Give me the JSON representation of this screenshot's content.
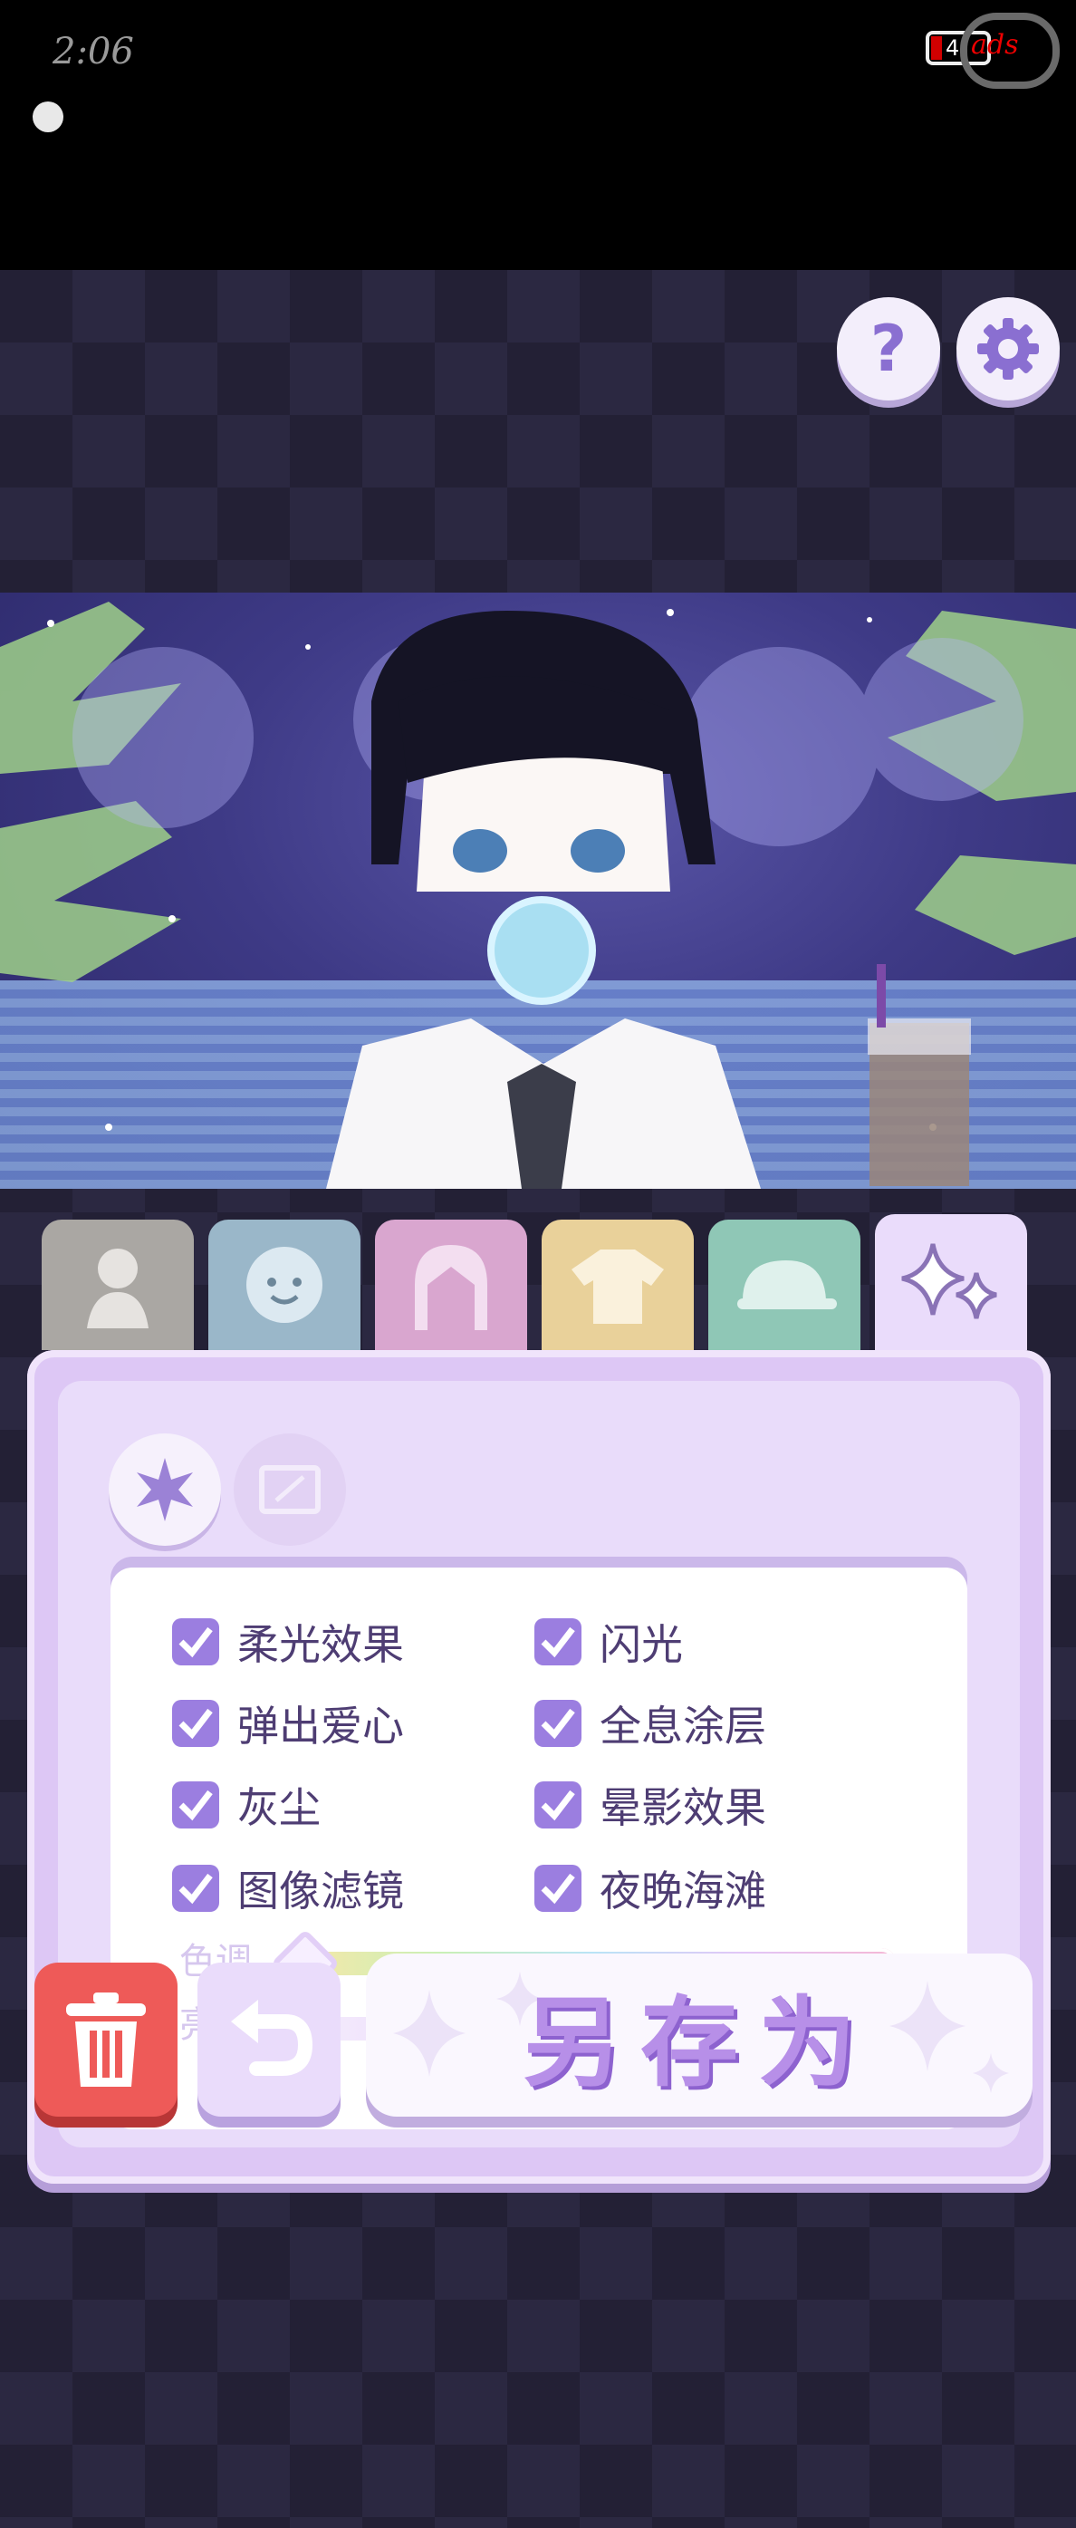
{
  "status": {
    "time": "2:06",
    "battery_level": "4"
  },
  "toolbar": {
    "help_label": "?"
  },
  "tabs": [
    {
      "name": "body",
      "color": "#aaa7a3",
      "icon": "body-icon"
    },
    {
      "name": "face",
      "color": "#9ab7c9",
      "icon": "face-icon"
    },
    {
      "name": "hair",
      "color": "#d9a6cf",
      "icon": "hair-icon"
    },
    {
      "name": "clothes",
      "color": "#e9d19a",
      "icon": "shirt-icon"
    },
    {
      "name": "hat",
      "color": "#8fc7b6",
      "icon": "cap-icon"
    },
    {
      "name": "effects",
      "color": "#eadcfb",
      "icon": "sparkle-icon",
      "active": true
    }
  ],
  "effects": {
    "options": [
      {
        "label": "柔光效果",
        "checked": true
      },
      {
        "label": "闪光",
        "checked": true
      },
      {
        "label": "弹出爱心",
        "checked": true
      },
      {
        "label": "全息涂层",
        "checked": true
      },
      {
        "label": "灰尘",
        "checked": true
      },
      {
        "label": "晕影效果",
        "checked": true
      },
      {
        "label": "图像滤镜",
        "checked": true
      },
      {
        "label": "夜晚海滩",
        "checked": true
      }
    ],
    "hue_label": "色调",
    "brightness_label": "亮度",
    "hue_value": 0,
    "brightness_value": 0
  },
  "actions": {
    "save_as_label": "另存为"
  }
}
